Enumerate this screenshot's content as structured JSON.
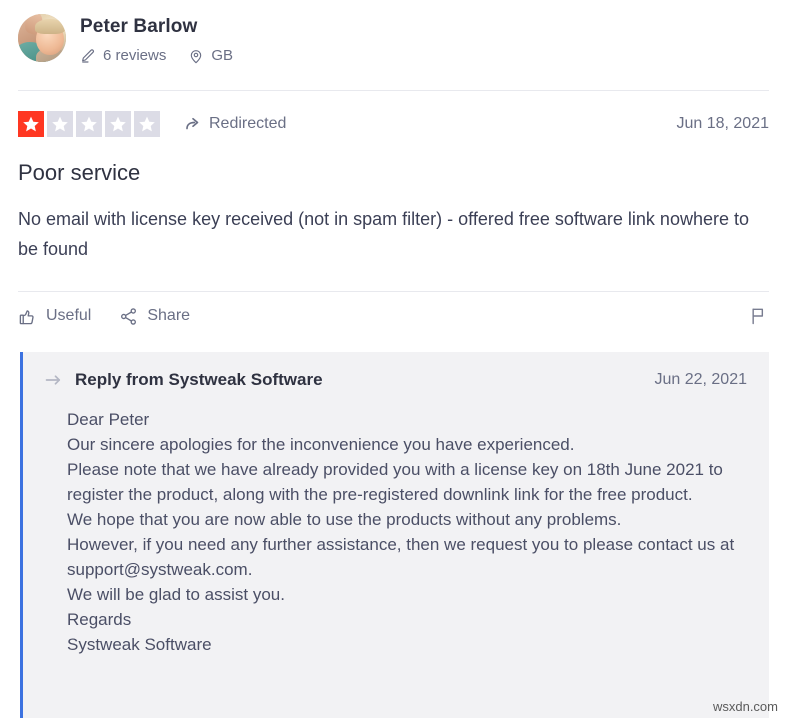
{
  "reviewer": {
    "name": "Peter Barlow",
    "reviews_count_label": "6 reviews",
    "country_label": "GB",
    "avatar_icon": "user-photo-avatar",
    "reviews_icon": "pencil-icon",
    "location_icon": "location-pin-icon"
  },
  "rating": {
    "value": 1,
    "max": 5,
    "filled_color": "#ff3722",
    "empty_color": "#dcdce6",
    "star_icon": "star-icon"
  },
  "redirected": {
    "label": "Redirected",
    "icon": "share-arrow-icon"
  },
  "review": {
    "date": "Jun 18, 2021",
    "title": "Poor service",
    "body": "No email with license key received (not in spam filter) - offered free software link nowhere to be found"
  },
  "actions": {
    "useful_label": "Useful",
    "useful_icon": "thumbs-up-icon",
    "share_label": "Share",
    "share_icon": "share-network-icon",
    "flag_icon": "flag-icon"
  },
  "reply": {
    "arrow_icon": "reply-arrow-icon",
    "from_label": "Reply from Systweak Software",
    "date": "Jun 22, 2021",
    "accent_color": "#3c72e0",
    "background_color": "#f2f2f4",
    "body": "Dear Peter\nOur sincere apologies for the inconvenience you have experienced.\nPlease note that we have already provided you with a license key on 18th June 2021 to register the product, along with the pre-registered downlink link for the free product.\nWe hope that you are now able to use the products without any problems.\nHowever, if you need any further assistance, then we request you to please contact us at support@systweak.com.\nWe will be glad to assist you.\nRegards\nSystweak Software"
  },
  "watermark": {
    "text": "wsxdn.com"
  }
}
